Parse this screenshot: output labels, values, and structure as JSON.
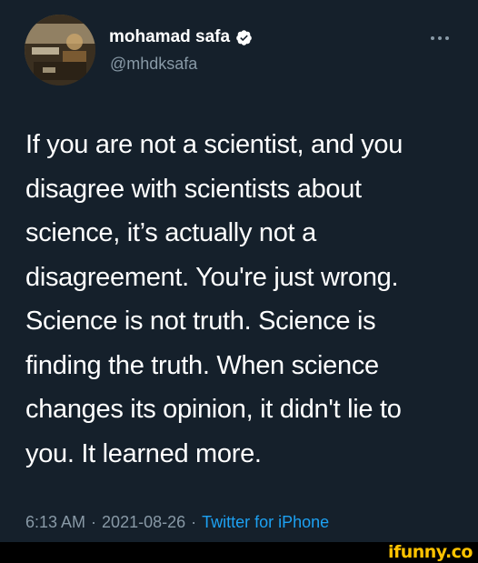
{
  "author": {
    "display_name": "mohamad safa",
    "handle": "@mhdksafa",
    "verified": true,
    "avatar_icon": "profile-photo",
    "verified_icon": "verified-badge-icon",
    "more_icon": "more-options-icon"
  },
  "tweet": {
    "lines": [
      "If you are not a scientist, and you",
      "disagree with scientists about",
      "science, it’s actually not a",
      "disagreement. You're just wrong.",
      "Science is not truth. Science is",
      "finding the truth. When science",
      "changes its opinion, it didn't lie to",
      "you. It learned more."
    ]
  },
  "meta": {
    "time": "6:13 AM",
    "separator": "·",
    "date": "2021-08-26",
    "source": "Twitter for iPhone"
  },
  "watermark": {
    "text": "ifunny.co",
    "color": "#ffc300"
  },
  "colors": {
    "background": "#15202b",
    "text": "#ffffff",
    "secondary": "#8899a6",
    "link": "#1da1f2"
  }
}
